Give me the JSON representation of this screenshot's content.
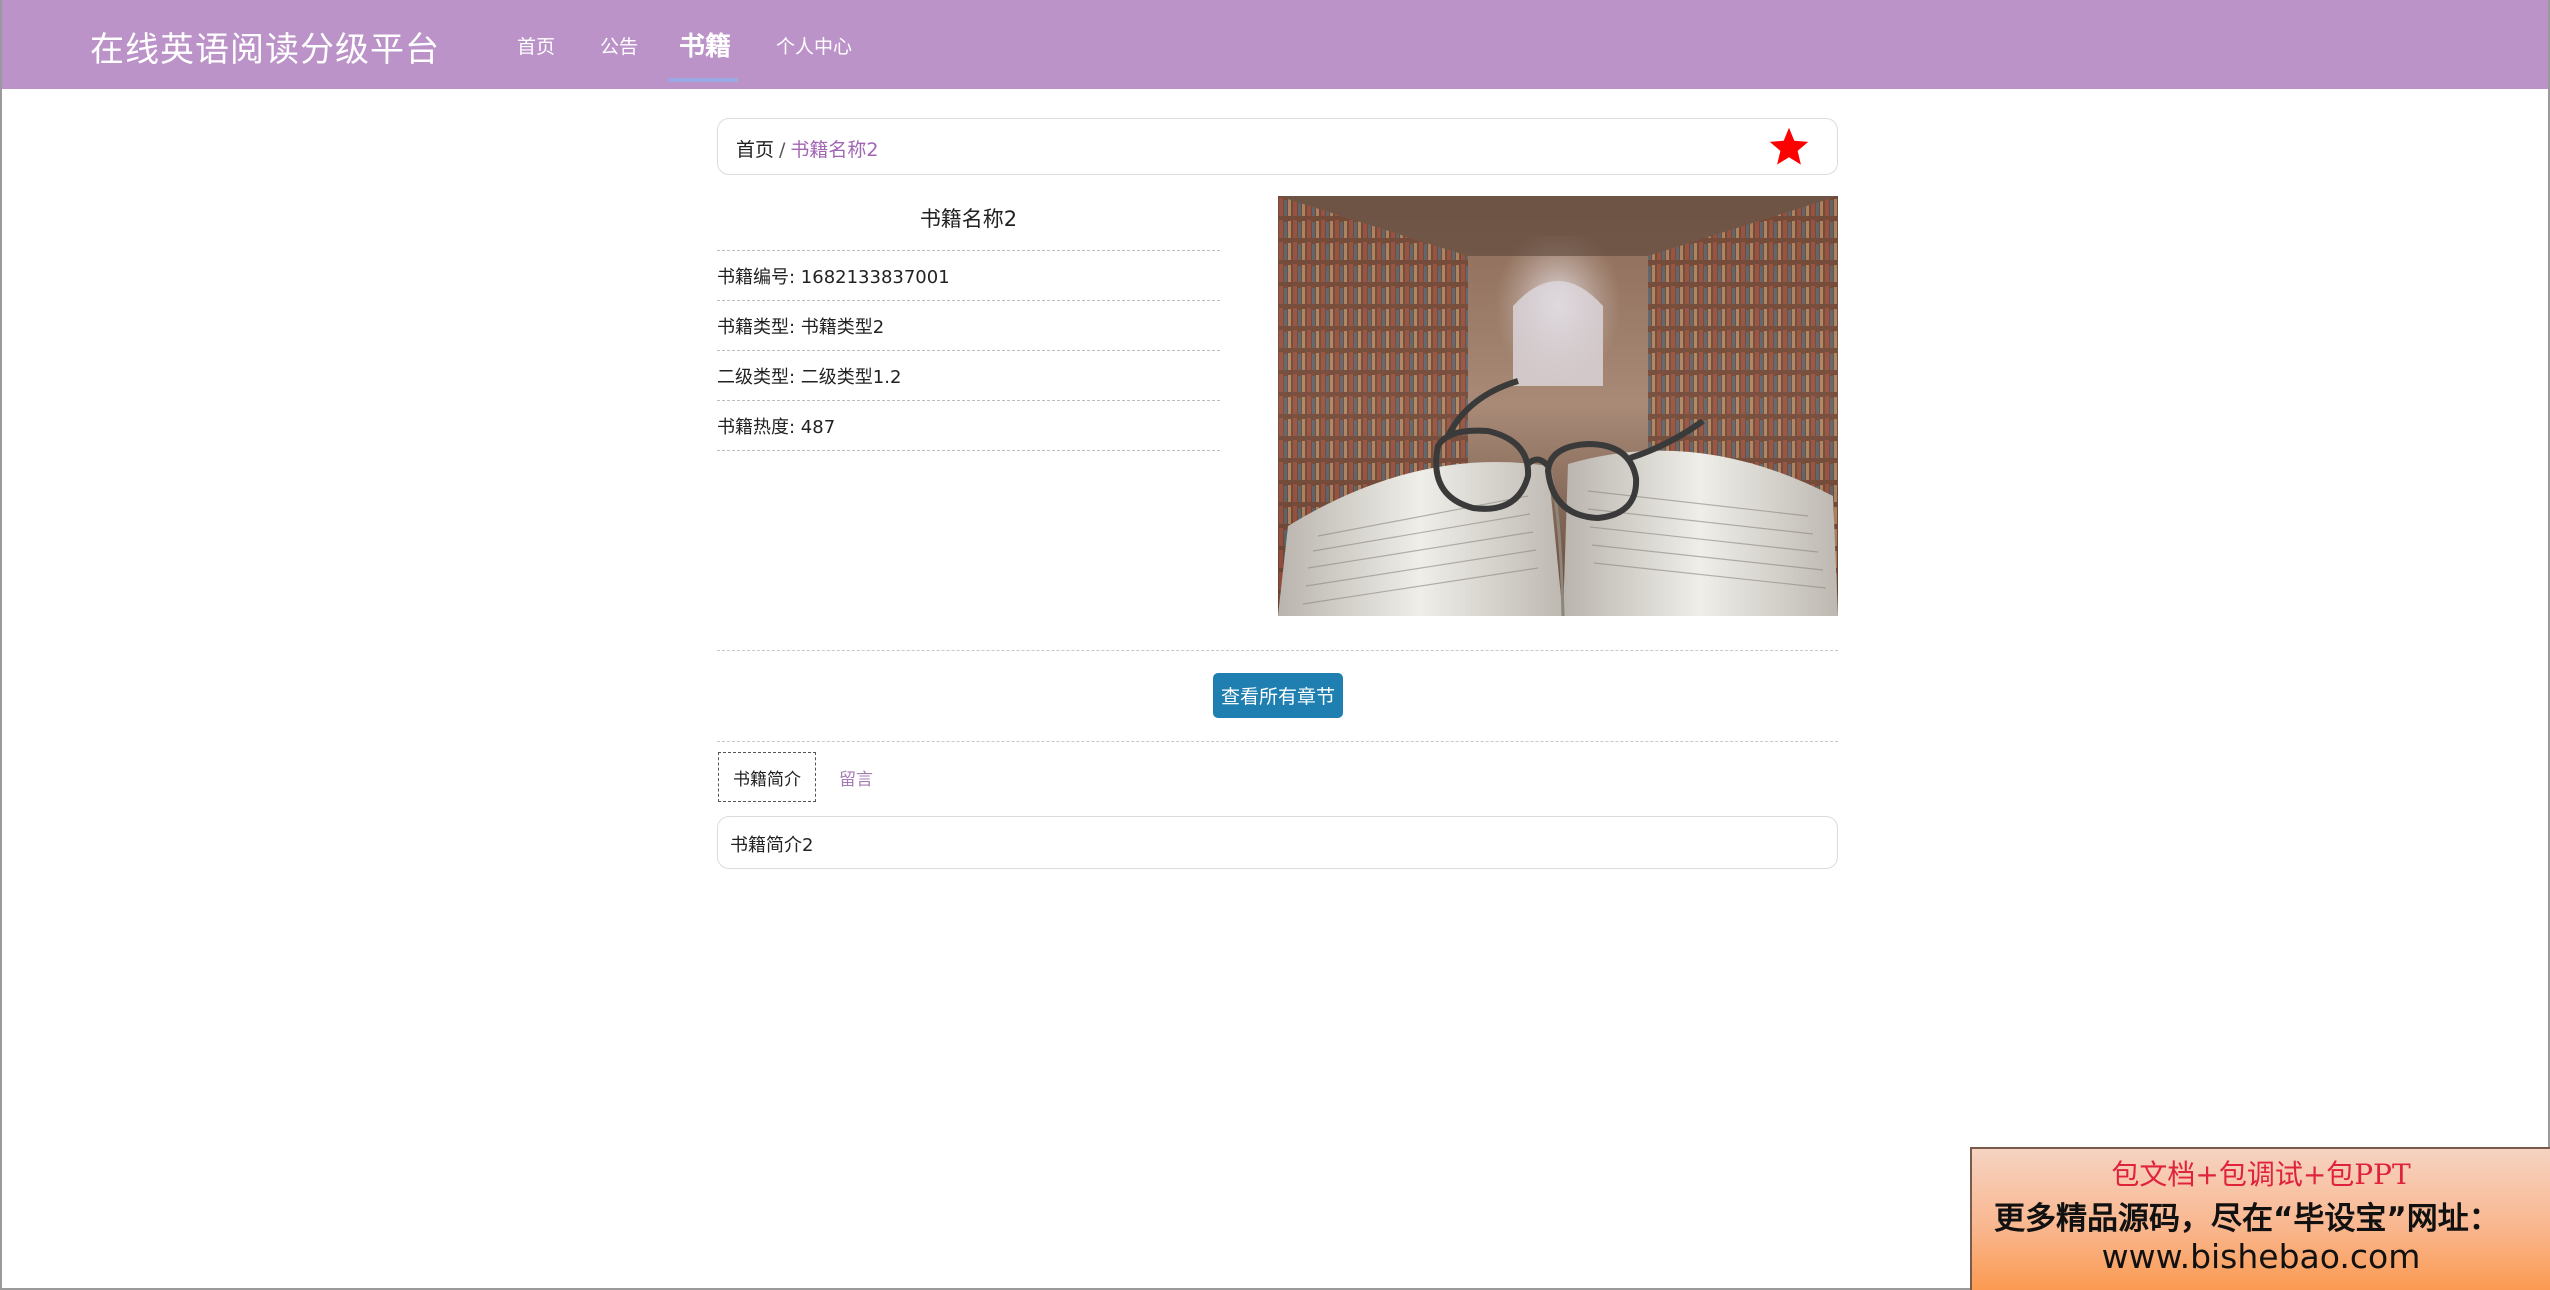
{
  "header": {
    "brand": "在线英语阅读分级平台",
    "nav": [
      {
        "label": "首页"
      },
      {
        "label": "公告"
      },
      {
        "label": "书籍"
      },
      {
        "label": "个人中心"
      }
    ],
    "active_index": 2
  },
  "breadcrumb": {
    "home": "首页",
    "separator": "/",
    "current": "书籍名称2"
  },
  "book": {
    "title": "书籍名称2",
    "fields": [
      {
        "text": "书籍编号: 1682133837001"
      },
      {
        "text": "书籍类型: 书籍类型2"
      },
      {
        "text": "二级类型: 二级类型1.2"
      },
      {
        "text": "书籍热度: 487"
      }
    ],
    "cover_icon": "open-book-with-glasses-photo"
  },
  "actions": {
    "chapters_button": "查看所有章节"
  },
  "tabs": [
    {
      "label": "书籍简介"
    },
    {
      "label": "留言"
    }
  ],
  "intro_text": "书籍简介2",
  "ad": {
    "line1": "包文档+包调试+包PPT",
    "line2": "更多精品源码，尽在“毕设宝”网址：",
    "line3": "www.bishebao.com"
  },
  "colors": {
    "navbar": "#bc93c8",
    "accent": "#a266b4",
    "button": "#1e7fb0",
    "star": "#ff0000"
  }
}
